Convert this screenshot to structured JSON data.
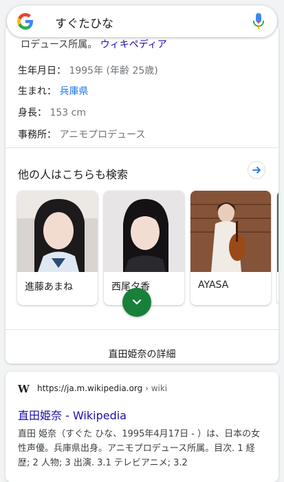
{
  "search": {
    "query": "すぐたひな"
  },
  "facts_cut_line": {
    "text": "ロデュース所属。",
    "link": "ウィキペディア"
  },
  "facts": [
    {
      "label": "生年月日：",
      "value": "1995年 (年齢 25歳)"
    },
    {
      "label": "生まれ：",
      "value": "兵庫県"
    },
    {
      "label": "身長：",
      "value": "153 cm"
    },
    {
      "label": "事務所：",
      "value": "アニモプロデュース"
    }
  ],
  "people_also_search": {
    "title": "他の人はこちらも検索",
    "items": [
      {
        "name": "進藤あまね"
      },
      {
        "name": "西尾夕香"
      },
      {
        "name": "AYASA"
      }
    ]
  },
  "more_details": {
    "label": "直田姫奈の詳細"
  },
  "wiki_result": {
    "logo": "W",
    "url": "https://ja.m.wikipedia.org",
    "breadcrumb": " › wiki",
    "title": "直田姫奈 - Wikipedia",
    "snippet": "直田 姫奈（すぐた ひな、1995年4月17日 - ）は、日本の女性声優。兵庫県出身。アニモプロデュース所属。目次. 1 経歴; 2 人物; 3 出演. 3.1 テレビアニメ; 3.2"
  },
  "colors": {
    "link_blue": "#1a73e8",
    "title_blue": "#1a0dab",
    "expand_green": "#188038"
  }
}
